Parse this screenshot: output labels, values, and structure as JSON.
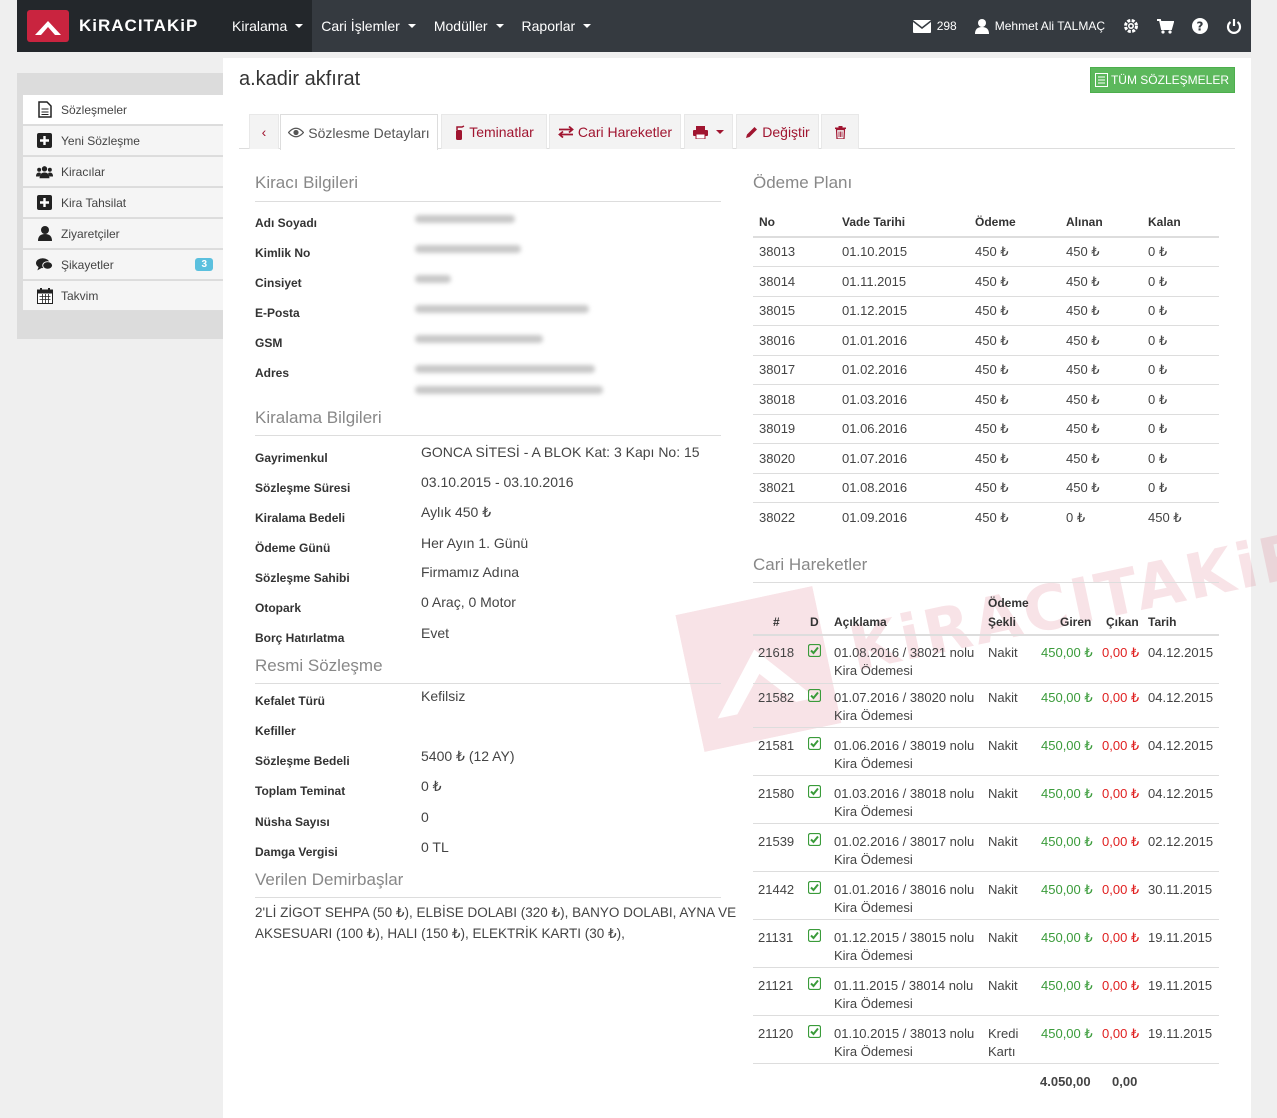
{
  "brand": "KiRACITAKiP",
  "nav": {
    "items": [
      "Kiralama",
      "Cari İşlemler",
      "Modüller",
      "Raporlar"
    ],
    "messages_count": "298",
    "user_name": "Mehmet Ali TALMAÇ"
  },
  "sidebar": {
    "items": [
      {
        "label": "Sözleşmeler",
        "icon": "document-icon"
      },
      {
        "label": "Yeni Sözleşme",
        "icon": "plus-square-icon"
      },
      {
        "label": "Kiracılar",
        "icon": "users-icon"
      },
      {
        "label": "Kira Tahsilat",
        "icon": "plus-square-icon"
      },
      {
        "label": "Ziyaretçiler",
        "icon": "user-icon"
      },
      {
        "label": "Şikayetler",
        "icon": "comments-icon",
        "badge": "3"
      },
      {
        "label": "Takvim",
        "icon": "calendar-icon"
      }
    ]
  },
  "page": {
    "title": "a.kadir akfırat",
    "all_contracts_button": "TÜM SÖZLEŞMELER"
  },
  "tabs": {
    "details": "Sözlesme Detayları",
    "guarantees": "Teminatlar",
    "transactions": "Cari Hareketler",
    "edit": "Değiştir"
  },
  "tenant": {
    "title": "Kiracı Bilgileri",
    "labels": [
      "Adı Soyadı",
      "Kimlik No",
      "Cinsiyet",
      "E-Posta",
      "GSM",
      "Adres"
    ]
  },
  "rental": {
    "title": "Kiralama Bilgileri",
    "rows": [
      {
        "label": "Gayrimenkul",
        "value": "GONCA SİTESİ - A BLOK Kat: 3 Kapı No: 15"
      },
      {
        "label": "Sözleşme Süresi",
        "value": "03.10.2015 - 03.10.2016"
      },
      {
        "label": "Kiralama Bedeli",
        "value": "Aylık 450 ₺"
      },
      {
        "label": "Ödeme Günü",
        "value": "Her Ayın 1. Günü"
      },
      {
        "label": "Sözleşme Sahibi",
        "value": "Firmamız Adına"
      },
      {
        "label": "Otopark",
        "value": "0 Araç, 0 Motor"
      },
      {
        "label": "Borç Hatırlatma",
        "value": "Evet"
      }
    ]
  },
  "official": {
    "title": "Resmi Sözleşme",
    "rows": [
      {
        "label": "Kefalet Türü",
        "value": "Kefilsiz"
      },
      {
        "label": "Kefiller",
        "value": ""
      },
      {
        "label": "Sözleşme Bedeli",
        "value": "5400 ₺ (12 AY)"
      },
      {
        "label": "Toplam Teminat",
        "value": "0 ₺"
      },
      {
        "label": "Nüsha Sayısı",
        "value": "0"
      },
      {
        "label": "Damga Vergisi",
        "value": "0 TL"
      }
    ]
  },
  "fixtures": {
    "title": "Verilen Demirbaşlar",
    "line1": "2'Lİ ZİGOT SEHPA (50 ₺), ELBİSE DOLABI (320 ₺), BANYO DOLABI, AYNA VE",
    "line2": "AKSESUARI (100 ₺), HALI (150 ₺), ELEKTRİK KARTI (30 ₺),"
  },
  "payment_plan": {
    "title": "Ödeme Planı",
    "headers": [
      "No",
      "Vade Tarihi",
      "Ödeme",
      "Alınan",
      "Kalan"
    ],
    "rows": [
      [
        "38013",
        "01.10.2015",
        "450 ₺",
        "450 ₺",
        "0 ₺"
      ],
      [
        "38014",
        "01.11.2015",
        "450 ₺",
        "450 ₺",
        "0 ₺"
      ],
      [
        "38015",
        "01.12.2015",
        "450 ₺",
        "450 ₺",
        "0 ₺"
      ],
      [
        "38016",
        "01.01.2016",
        "450 ₺",
        "450 ₺",
        "0 ₺"
      ],
      [
        "38017",
        "01.02.2016",
        "450 ₺",
        "450 ₺",
        "0 ₺"
      ],
      [
        "38018",
        "01.03.2016",
        "450 ₺",
        "450 ₺",
        "0 ₺"
      ],
      [
        "38019",
        "01.06.2016",
        "450 ₺",
        "450 ₺",
        "0 ₺"
      ],
      [
        "38020",
        "01.07.2016",
        "450 ₺",
        "450 ₺",
        "0 ₺"
      ],
      [
        "38021",
        "01.08.2016",
        "450 ₺",
        "450 ₺",
        "0 ₺"
      ],
      [
        "38022",
        "01.09.2016",
        "450 ₺",
        "0 ₺",
        "450 ₺"
      ]
    ]
  },
  "transactions": {
    "title": "Cari Hareketler",
    "headers": [
      "#",
      "D",
      "Açıklama",
      "Ödeme",
      "Şekli",
      "Giren",
      "Çıkan",
      "Tarih"
    ],
    "rows": [
      {
        "id": "21618",
        "desc1": "01.08.2016 / 38021 nolu",
        "desc2": "Kira Ödemesi",
        "method1": "Nakit",
        "method2": "",
        "in": "450,00 ₺",
        "out": "0,00 ₺",
        "date": "04.12.2015"
      },
      {
        "id": "21582",
        "desc1": "01.07.2016 / 38020 nolu",
        "desc2": "Kira Ödemesi",
        "method1": "Nakit",
        "method2": "",
        "in": "450,00 ₺",
        "out": "0,00 ₺",
        "date": "04.12.2015"
      },
      {
        "id": "21581",
        "desc1": "01.06.2016 / 38019 nolu",
        "desc2": "Kira Ödemesi",
        "method1": "Nakit",
        "method2": "",
        "in": "450,00 ₺",
        "out": "0,00 ₺",
        "date": "04.12.2015"
      },
      {
        "id": "21580",
        "desc1": "01.03.2016 / 38018 nolu",
        "desc2": "Kira Ödemesi",
        "method1": "Nakit",
        "method2": "",
        "in": "450,00 ₺",
        "out": "0,00 ₺",
        "date": "04.12.2015"
      },
      {
        "id": "21539",
        "desc1": "01.02.2016 / 38017 nolu",
        "desc2": "Kira Ödemesi",
        "method1": "Nakit",
        "method2": "",
        "in": "450,00 ₺",
        "out": "0,00 ₺",
        "date": "02.12.2015"
      },
      {
        "id": "21442",
        "desc1": "01.01.2016 / 38016 nolu",
        "desc2": "Kira Ödemesi",
        "method1": "Nakit",
        "method2": "",
        "in": "450,00 ₺",
        "out": "0,00 ₺",
        "date": "30.11.2015"
      },
      {
        "id": "21131",
        "desc1": "01.12.2015 / 38015 nolu",
        "desc2": "Kira Ödemesi",
        "method1": "Nakit",
        "method2": "",
        "in": "450,00 ₺",
        "out": "0,00 ₺",
        "date": "19.11.2015"
      },
      {
        "id": "21121",
        "desc1": "01.11.2015 / 38014 nolu",
        "desc2": "Kira Ödemesi",
        "method1": "Nakit",
        "method2": "",
        "in": "450,00 ₺",
        "out": "0,00 ₺",
        "date": "19.11.2015"
      },
      {
        "id": "21120",
        "desc1": "01.10.2015 / 38013 nolu",
        "desc2": "Kira Ödemesi",
        "method1": "Kredi",
        "method2": "Kartı",
        "in": "450,00 ₺",
        "out": "0,00 ₺",
        "date": "19.11.2015"
      }
    ],
    "total_in": "4.050,00",
    "total_out": "0,00"
  },
  "watermark": "KiRACITAKiP",
  "colors": {
    "accent": "#c9243f",
    "nav_bg": "#353a40",
    "success": "#5cb85c",
    "badge": "#5bc0de"
  }
}
